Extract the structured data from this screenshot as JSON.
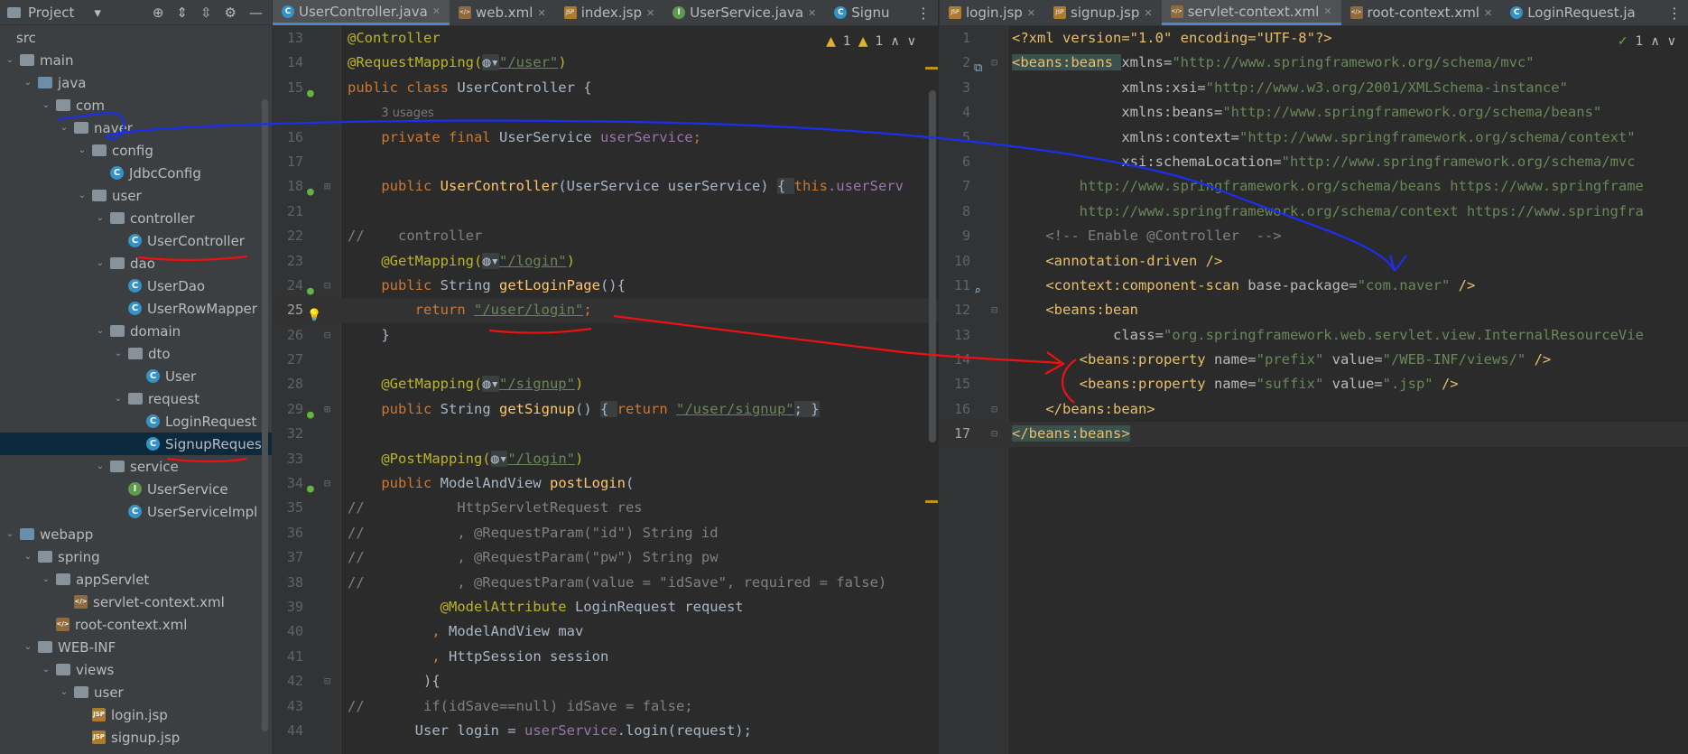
{
  "project_panel": {
    "title": "Project",
    "tree": [
      {
        "label": "src",
        "depth": 0,
        "type": "none",
        "arrow": ""
      },
      {
        "label": "main",
        "depth": 0,
        "type": "folder",
        "arrow": "v"
      },
      {
        "label": "java",
        "depth": 1,
        "type": "folder-blue",
        "arrow": "v"
      },
      {
        "label": "com",
        "depth": 2,
        "type": "folder",
        "arrow": "v"
      },
      {
        "label": "naver",
        "depth": 3,
        "type": "folder",
        "arrow": "v"
      },
      {
        "label": "config",
        "depth": 4,
        "type": "folder",
        "arrow": "v"
      },
      {
        "label": "JdbcConfig",
        "depth": 5,
        "type": "class",
        "arrow": ""
      },
      {
        "label": "user",
        "depth": 4,
        "type": "folder",
        "arrow": "v"
      },
      {
        "label": "controller",
        "depth": 5,
        "type": "folder",
        "arrow": "v"
      },
      {
        "label": "UserController",
        "depth": 6,
        "type": "class",
        "arrow": ""
      },
      {
        "label": "dao",
        "depth": 5,
        "type": "folder",
        "arrow": "v"
      },
      {
        "label": "UserDao",
        "depth": 6,
        "type": "class",
        "arrow": ""
      },
      {
        "label": "UserRowMapper",
        "depth": 6,
        "type": "class",
        "arrow": ""
      },
      {
        "label": "domain",
        "depth": 5,
        "type": "folder",
        "arrow": "v"
      },
      {
        "label": "dto",
        "depth": 6,
        "type": "folder",
        "arrow": "v"
      },
      {
        "label": "User",
        "depth": 7,
        "type": "class",
        "arrow": ""
      },
      {
        "label": "request",
        "depth": 6,
        "type": "folder",
        "arrow": "v"
      },
      {
        "label": "LoginRequest",
        "depth": 7,
        "type": "class",
        "arrow": ""
      },
      {
        "label": "SignupRequest",
        "depth": 7,
        "type": "class",
        "arrow": "",
        "selected": true
      },
      {
        "label": "service",
        "depth": 5,
        "type": "folder",
        "arrow": "v"
      },
      {
        "label": "UserService",
        "depth": 6,
        "type": "interface",
        "arrow": ""
      },
      {
        "label": "UserServiceImpl",
        "depth": 6,
        "type": "class",
        "arrow": ""
      },
      {
        "label": "webapp",
        "depth": 0,
        "type": "folder-blue",
        "arrow": "v"
      },
      {
        "label": "spring",
        "depth": 1,
        "type": "folder",
        "arrow": "v"
      },
      {
        "label": "appServlet",
        "depth": 2,
        "type": "folder",
        "arrow": "v"
      },
      {
        "label": "servlet-context.xml",
        "depth": 3,
        "type": "xml",
        "arrow": ""
      },
      {
        "label": "root-context.xml",
        "depth": 2,
        "type": "xml",
        "arrow": ""
      },
      {
        "label": "WEB-INF",
        "depth": 1,
        "type": "folder",
        "arrow": "v"
      },
      {
        "label": "views",
        "depth": 2,
        "type": "folder",
        "arrow": "v"
      },
      {
        "label": "user",
        "depth": 3,
        "type": "folder",
        "arrow": "v"
      },
      {
        "label": "login.jsp",
        "depth": 4,
        "type": "jsp",
        "arrow": ""
      },
      {
        "label": "signup.jsp",
        "depth": 4,
        "type": "jsp",
        "arrow": ""
      }
    ]
  },
  "left_editor": {
    "tabs": [
      {
        "label": "UserController.java",
        "icon": "class",
        "active": true
      },
      {
        "label": "web.xml",
        "icon": "xml"
      },
      {
        "label": "index.jsp",
        "icon": "jsp"
      },
      {
        "label": "UserService.java",
        "icon": "interface"
      },
      {
        "label": "Signu",
        "icon": "class"
      }
    ],
    "inspection": {
      "warnings": "1",
      "weak": "1"
    },
    "line_numbers": [
      "13",
      "14",
      "15",
      "",
      "16",
      "17",
      "18",
      "21",
      "22",
      "23",
      "24",
      "25",
      "26",
      "27",
      "28",
      "29",
      "32",
      "33",
      "34",
      "35",
      "36",
      "37",
      "38",
      "39",
      "40",
      "41",
      "42",
      "43",
      "44"
    ],
    "code": {
      "l13": "@Controller",
      "l14_a": "@RequestMapping(",
      "l14_b": "\"/user\"",
      "l14_c": ")",
      "l15_kw": "public class ",
      "l15_name": "UserController {",
      "usages": "3 usages",
      "l16_kw": "private final ",
      "l16_type": "UserService ",
      "l16_fld": "userService",
      "l16_end": ";",
      "l18_kw": "public ",
      "l18_fn": "UserController",
      "l18_params": "(UserService userService) ",
      "l18_brace": "{ ",
      "l18_this": "this",
      "l18_rest": ".userServ",
      "l21": "//    controller",
      "l22_a": "@GetMapping(",
      "l22_b": "\"/login\"",
      "l22_c": ")",
      "l23_kw": "public ",
      "l23_type": "String ",
      "l23_fn": "getLoginPage",
      "l23_end": "(){",
      "l24_kw": "return ",
      "l24_str": "\"/user/login\"",
      "l24_end": ";",
      "l25": "}",
      "l27_a": "@GetMapping(",
      "l27_b": "\"/signup\"",
      "l27_c": ")",
      "l28_kw": "public ",
      "l28_type": "String ",
      "l28_fn": "getSignup",
      "l28_end": "() ",
      "l28_brace": "{ ",
      "l28_ret": "return ",
      "l28_str": "\"/user/signup\"",
      "l28_tail": "; }",
      "l32_a": "@PostMapping(",
      "l32_b": "\"/login\"",
      "l32_c": ")",
      "l33_kw": "public ",
      "l33_type": "ModelAndView ",
      "l33_fn": "postLogin",
      "l33_end": "(",
      "l34": "//           HttpServletRequest res",
      "l35": "//           , @RequestParam(\"id\") String id",
      "l36": "//           , @RequestParam(\"pw\") String pw",
      "l37": "//           , @RequestParam(value = \"idSave\", required = false)",
      "l38_an": "@ModelAttribute ",
      "l38_rest": "LoginRequest request",
      "l39_comma": ", ",
      "l39_rest": "ModelAndView mav",
      "l40_comma": ", ",
      "l40_rest": "HttpSession session",
      "l41": "){",
      "l42": "//       if(idSave==null) idSave = false;",
      "l43_a": "User login = ",
      "l43_fld": "userService",
      "l43_b": ".login(request);"
    }
  },
  "right_editor": {
    "tabs": [
      {
        "label": "login.jsp",
        "icon": "jsp"
      },
      {
        "label": "signup.jsp",
        "icon": "jsp"
      },
      {
        "label": "servlet-context.xml",
        "icon": "xml",
        "active": true
      },
      {
        "label": "root-context.xml",
        "icon": "xml"
      },
      {
        "label": "LoginRequest.ja",
        "icon": "class"
      }
    ],
    "inspection": {
      "ok": "1"
    },
    "line_numbers": [
      "1",
      "2",
      "3",
      "4",
      "5",
      "6",
      "7",
      "8",
      "9",
      "10",
      "11",
      "12",
      "13",
      "14",
      "15",
      "16",
      "17"
    ],
    "code": {
      "x1": "<?xml version=\"1.0\" encoding=\"UTF-8\"?>",
      "x2_tag": "<beans:beans ",
      "x2_attr": "xmlns=",
      "x2_val": "\"http://www.springframework.org/schema/mvc\"",
      "x3_attr": "xmlns:xsi=",
      "x3_val": "\"http://www.w3.org/2001/XMLSchema-instance\"",
      "x4_attr": "xmlns:beans=",
      "x4_val": "\"http://www.springframework.org/schema/beans\"",
      "x5_attr": "xmlns:context=",
      "x5_val": "\"http://www.springframework.org/schema/context\"",
      "x6_attr": "xsi:schemaLocation=",
      "x6_val": "\"http://www.springframework.org/schema/mvc",
      "x7": "http://www.springframework.org/schema/beans https://www.springframe",
      "x8": "http://www.springframework.org/schema/context https://www.springfra",
      "x9": "<!-- Enable @Controller  -->",
      "x10": "<annotation-driven />",
      "x11_tag": "<context:component-scan ",
      "x11_attr": "base-package=",
      "x11_val": "\"com.naver\"",
      "x11_end": " />",
      "x12": "<beans:bean",
      "x13_attr": "class=",
      "x13_val": "\"org.springframework.web.servlet.view.InternalResourceVie",
      "x14_tag": "<beans:property ",
      "x14_attr1": "name=",
      "x14_val1": "\"prefix\"",
      "x14_attr2": " value=",
      "x14_val2": "\"/WEB-INF/views/\"",
      "x14_end": " />",
      "x15_tag": "<beans:property ",
      "x15_attr1": "name=",
      "x15_val1": "\"suffix\"",
      "x15_attr2": " value=",
      "x15_val2": "\".jsp\"",
      "x15_end": " />",
      "x16": "</beans:bean>",
      "x17": "</beans:beans>"
    }
  },
  "colors": {
    "annotation_blue": "#1a2ff0",
    "annotation_red": "#ee1111",
    "selection": "#0d293e"
  }
}
